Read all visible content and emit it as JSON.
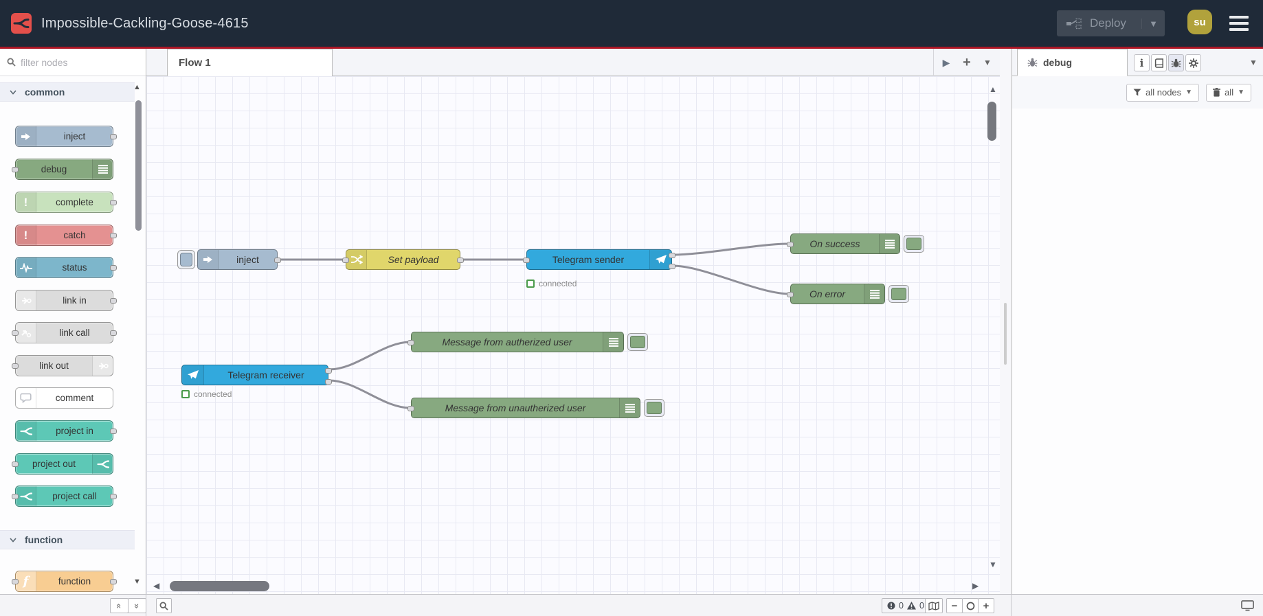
{
  "header": {
    "title": "Impossible-Cackling-Goose-4615",
    "deploy_label": "Deploy",
    "avatar_text": "su"
  },
  "palette": {
    "filter_placeholder": "filter nodes",
    "categories": [
      {
        "label": "common"
      },
      {
        "label": "function"
      }
    ],
    "nodes": [
      {
        "label": "inject",
        "color": "#a6bbcf",
        "icon": "inject-arrow-icon",
        "ports": "out"
      },
      {
        "label": "debug",
        "color": "#87a980",
        "icon": "debug-list-icon",
        "ports": "in"
      },
      {
        "label": "complete",
        "color": "#c8e2bd",
        "icon": "exclamation-icon",
        "ports": "out"
      },
      {
        "label": "catch",
        "color": "#e49191",
        "icon": "exclamation-icon",
        "ports": "out"
      },
      {
        "label": "status",
        "color": "#7db6cb",
        "icon": "pulse-icon",
        "ports": "out"
      },
      {
        "label": "link in",
        "color": "#dcdcdc",
        "icon": "link-icon",
        "ports": "out"
      },
      {
        "label": "link call",
        "color": "#dcdcdc",
        "icon": "link-icon",
        "ports": "both"
      },
      {
        "label": "link out",
        "color": "#dcdcdc",
        "icon": "link-icon",
        "ports": "in"
      },
      {
        "label": "comment",
        "color": "#ffffff",
        "icon": "comment-icon",
        "ports": "none"
      },
      {
        "label": "project in",
        "color": "#5dc8b6",
        "icon": "project-icon",
        "ports": "out"
      },
      {
        "label": "project out",
        "color": "#5dc8b6",
        "icon": "project-icon",
        "ports": "in"
      },
      {
        "label": "project call",
        "color": "#5dc8b6",
        "icon": "project-icon",
        "ports": "both"
      },
      {
        "label": "function",
        "color": "#f8cd92",
        "icon": "function-f-icon",
        "ports": "both"
      }
    ]
  },
  "workspace": {
    "tab_label": "Flow 1"
  },
  "flow": {
    "nodes": [
      {
        "label": "inject",
        "type": "inject"
      },
      {
        "label": "Set payload",
        "type": "change"
      },
      {
        "label": "Telegram sender",
        "type": "telegram-sender",
        "status": "connected"
      },
      {
        "label": "On success",
        "type": "debug"
      },
      {
        "label": "On error",
        "type": "debug"
      },
      {
        "label": "Telegram receiver",
        "type": "telegram-receiver",
        "status": "connected"
      },
      {
        "label": "Message from autherized user",
        "type": "debug"
      },
      {
        "label": "Message from unautherized user",
        "type": "debug"
      }
    ]
  },
  "sidebar": {
    "tab_label": "debug",
    "filter_button": "all nodes",
    "clear_button": "all"
  },
  "footer": {
    "error_count": "0",
    "warning_count": "0",
    "zoom_out": "−",
    "zoom_in": "+"
  },
  "colors": {
    "header_bg": "#1f2a38",
    "brand_red": "#e4504b",
    "unsaved_changes_bar": "#ad1625",
    "node_inject": "#a6bbcf",
    "node_debug": "#87a980",
    "node_change": "#e0d66b",
    "node_telegram": "#32a9dd",
    "node_project": "#5dc8b6",
    "status_connected_green": "#4b9b4b",
    "avatar_bg": "#b1a23c"
  }
}
